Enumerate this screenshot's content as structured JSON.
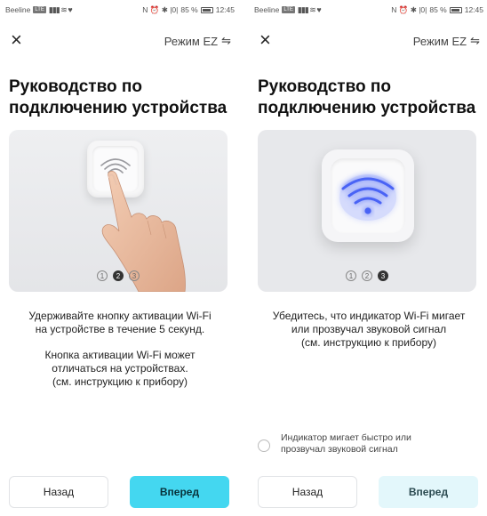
{
  "status_bar": {
    "carrier": "Beeline",
    "carrier_badge": "LTE",
    "signal_icons": "▮▮▮ ≋ ♥",
    "system_icons": "N ⏰ ✱ |0|",
    "battery": "85 %",
    "time": "12:45"
  },
  "screens": [
    {
      "close_label": "×",
      "mode_label": "Режим EZ",
      "mode_icon": "⇋",
      "title": [
        "Руководство по",
        "подключению устройства"
      ],
      "pager": {
        "dots": [
          "1",
          "2",
          "3"
        ],
        "active": 1
      },
      "description": [
        [
          "Удерживайте кнопку активации Wi-Fi",
          "на устройстве в течение 5 секунд."
        ],
        [
          "Кнопка активации Wi-Fi может",
          "отличаться на устройствах.",
          "(см. инструкцию к прибору)"
        ]
      ],
      "back_label": "Назад",
      "next_label": "Вперед"
    },
    {
      "close_label": "×",
      "mode_label": "Режим EZ",
      "mode_icon": "⇋",
      "title": [
        "Руководство по",
        "подключению устройства"
      ],
      "pager": {
        "dots": [
          "1",
          "2",
          "3"
        ],
        "active": 2
      },
      "description": [
        [
          "Убедитесь, что индикатор Wi-Fi мигает",
          "или прозвучал звуковой сигнал",
          "(см. инструкцию к прибору)"
        ]
      ],
      "checkbox_label": [
        "Индикатор мигает быстро или",
        "прозвучал звуковой сигнал"
      ],
      "checkbox_checked": false,
      "back_label": "Назад",
      "next_label": "Вперед"
    }
  ],
  "colors": {
    "accent": "#44d7f0",
    "accent_disabled": "#e3f7fb",
    "wifi_glow": "#4a63f5"
  }
}
